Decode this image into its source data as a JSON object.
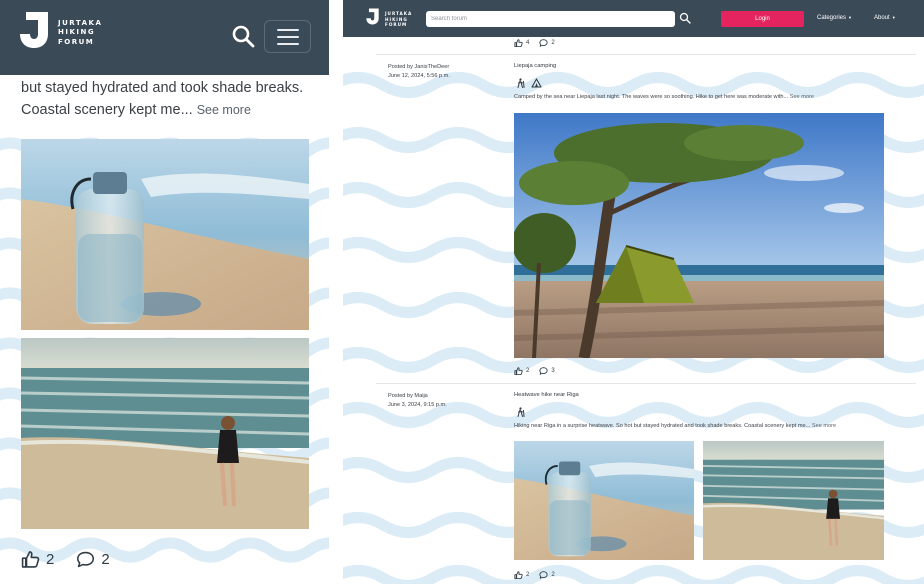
{
  "logo": {
    "line1": "JURTAKA",
    "line2": "HIKING",
    "line3": "FORUM"
  },
  "mobile": {
    "post_text": "but stayed hydrated and took shade breaks. Coastal scenery kept me...",
    "see_more": "See more",
    "likes": "2",
    "comments": "2",
    "icons": {
      "search": "search-icon",
      "menu": "hamburger-menu-icon"
    }
  },
  "desktop": {
    "search": {
      "placeholder": "Search forum"
    },
    "login_label": "Login",
    "nav": {
      "categories": "Categories",
      "about": "About"
    },
    "top_post": {
      "likes": "4",
      "comments": "2"
    },
    "posts": [
      {
        "posted_by": "Posted by JanisTheDeer",
        "date": "June 12, 2024, 5:56 p.m.",
        "title": "Liepaja camping",
        "category_icons": [
          "hiking-icon",
          "camping-tent-icon"
        ],
        "body": "Camped by the sea near Liepaja last night. The waves were so soothing. Hike to get here was moderate with...",
        "see_more": "See more",
        "likes": "2",
        "comments": "3"
      },
      {
        "posted_by": "Posted by Maija",
        "date": "June 3, 2024, 9:15 p.m.",
        "title": "Heatwave hike near Riga",
        "category_icons": [
          "hiking-icon"
        ],
        "body": "Hiking near Riga in a surprise heatwave. So hot but stayed hydrated and took shade breaks. Coastal scenery kept me...",
        "see_more": "See more",
        "likes": "2",
        "comments": "2"
      }
    ]
  },
  "colors": {
    "header": "#3b4a57",
    "accent": "#e3245e",
    "wave": "#dcecf6"
  }
}
